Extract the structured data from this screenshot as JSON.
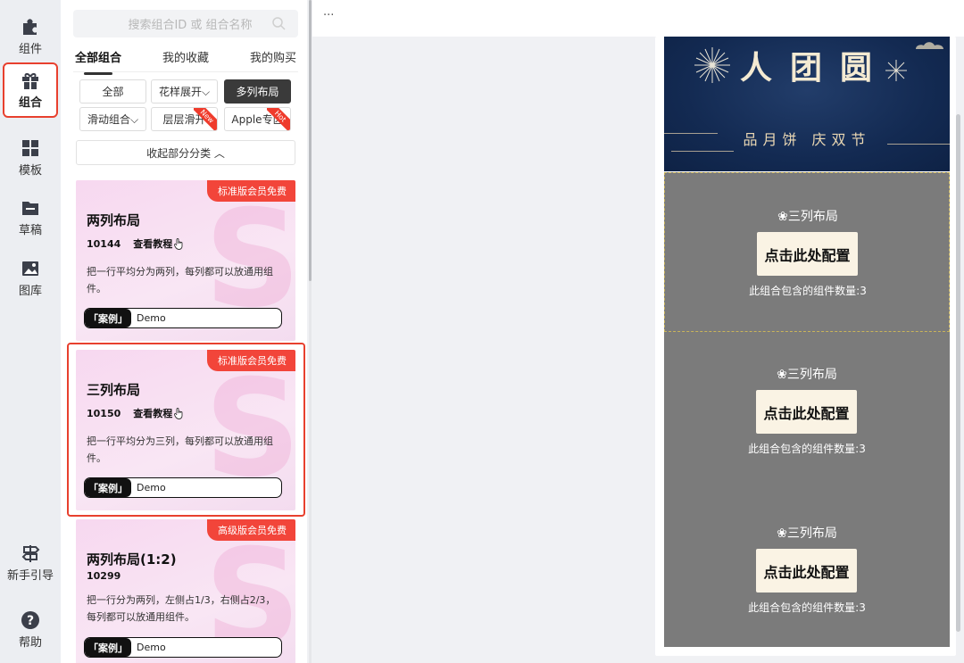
{
  "sidebar": {
    "items": [
      {
        "label": "组件",
        "icon": "puzzle-icon"
      },
      {
        "label": "组合",
        "icon": "gift-box-icon",
        "active": true
      },
      {
        "label": "模板",
        "icon": "template-grid-icon"
      },
      {
        "label": "草稿",
        "icon": "draft-folder-icon"
      },
      {
        "label": "图库",
        "icon": "image-gallery-icon"
      }
    ],
    "bottom": [
      {
        "label": "新手引导",
        "icon": "signpost-icon"
      },
      {
        "label": "帮助",
        "icon": "help-circle-icon"
      }
    ]
  },
  "panel": {
    "search_placeholder": "搜索组合ID 或 组合名称",
    "tabs": [
      "全部组合",
      "我的收藏",
      "我的购买"
    ],
    "filters": [
      {
        "label": "全部"
      },
      {
        "label": "花样展开⌵"
      },
      {
        "label": "多列布局",
        "selected": true
      },
      {
        "label": "滑动组合⌵"
      },
      {
        "label": "层层滑开",
        "corner": "New"
      },
      {
        "label": "Apple专区",
        "corner": "Hot"
      }
    ],
    "collapse_label": "收起部分分类 ︿",
    "cards": [
      {
        "badge": "标准版会员免费",
        "title": "两列布局",
        "id": "10144",
        "tutorial": "查看教程",
        "desc": "把一行平均分为两列，每列都可以放通用组件。",
        "demo_tag": "「案例」",
        "demo_text": "Demo"
      },
      {
        "badge": "标准版会员免费",
        "title": "三列布局",
        "id": "10150",
        "tutorial": "查看教程",
        "desc": "把一行平均分为三列，每列都可以放通用组件。",
        "demo_tag": "「案例」",
        "demo_text": "Demo"
      },
      {
        "badge": "高级版会员免费",
        "title": "两列布局(1:2)",
        "id": "10299",
        "tutorial": "",
        "desc": "把一行分为两列，左侧占1/3，右侧占2/3，每列都可以放通用组件。",
        "demo_tag": "「案例」",
        "demo_text": "Demo"
      }
    ]
  },
  "canvas": {
    "topbar_text": "···",
    "banner": {
      "headline": "人团圆",
      "subline": "品月饼 庆双节"
    },
    "blocks": [
      {
        "caption": "❀三列布局",
        "button": "点击此处配置",
        "count": "此组合包含的组件数量:3"
      },
      {
        "caption": "❀三列布局",
        "button": "点击此处配置",
        "count": "此组合包含的组件数量:3"
      },
      {
        "caption": "❀三列布局",
        "button": "点击此处配置",
        "count": "此组合包含的组件数量:3"
      }
    ]
  },
  "colors": {
    "accent_red": "#e8402e",
    "badge_red": "#f2453a",
    "card_pink": "#f7d8f0",
    "banner_navy": "#132a52",
    "block_gray": "#7b7b7b"
  }
}
